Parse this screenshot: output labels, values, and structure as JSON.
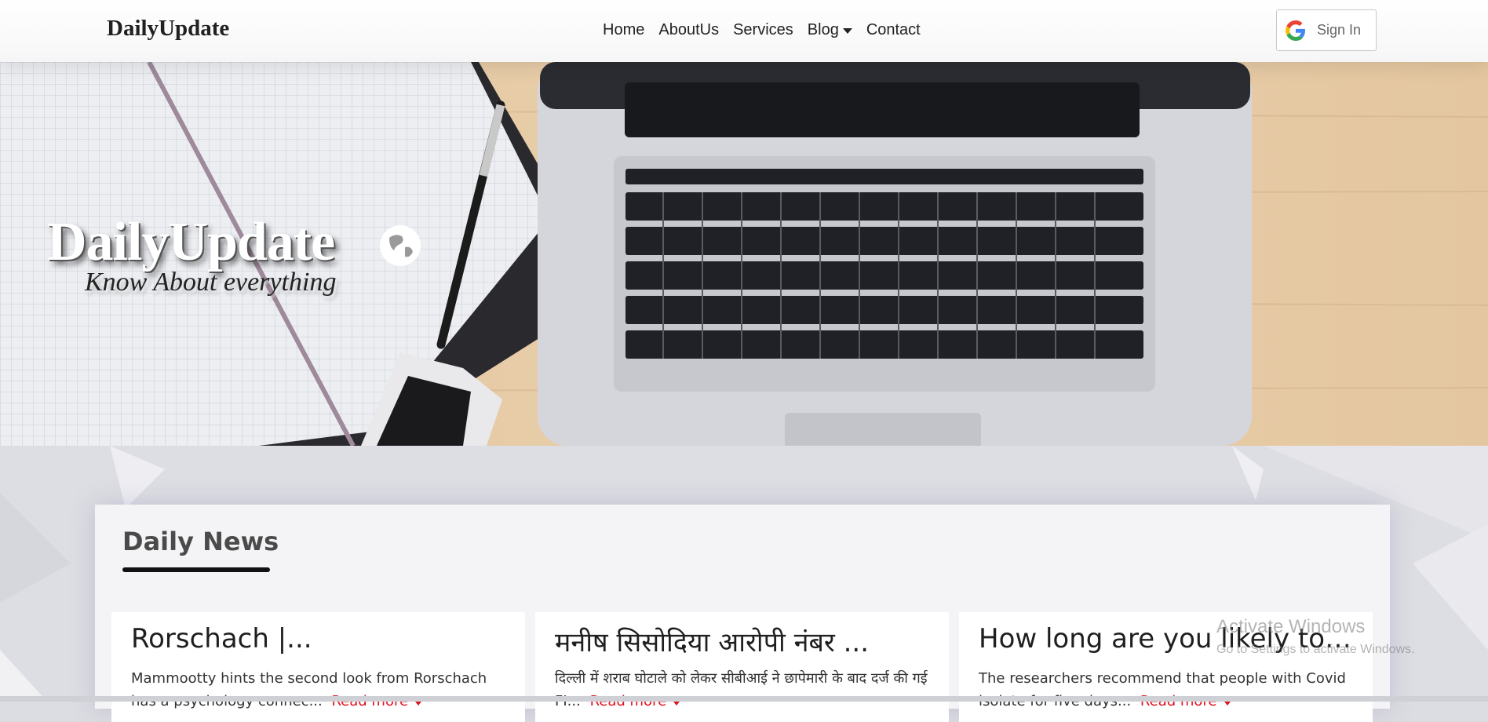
{
  "navbar": {
    "brand": "DailyUpdate",
    "links": [
      "Home",
      "AboutUs",
      "Services",
      "Blog",
      "Contact"
    ],
    "signin_label": "Sign In"
  },
  "hero": {
    "title": "DailyUpdate",
    "tagline": "Know About everything"
  },
  "news": {
    "heading": "Daily News",
    "cards": [
      {
        "title": "Rorschach |...",
        "text": "Mammootty hints the second look from Rorschach has a psychology connec...",
        "read_more": "Read more"
      },
      {
        "title": "मनीष सिसोदिया आरोपी नंबर ...",
        "text": "दिल्ली में शराब घोटाले को लेकर सीबीआई ने छापेमारी के बाद दर्ज की गई FI...",
        "read_more": "Read more"
      },
      {
        "title": "How long are you likely to b...",
        "text": "The researchers recommend that people with Covid isolate for five days...",
        "read_more": "Read more"
      }
    ]
  },
  "watermark": {
    "line1": "Activate Windows",
    "line2": "Go to Settings to activate Windows."
  },
  "colors": {
    "accent_red": "#e0101c",
    "navbar_bg": "#f7f7f8",
    "panel_bg": "#f4f4f6"
  }
}
